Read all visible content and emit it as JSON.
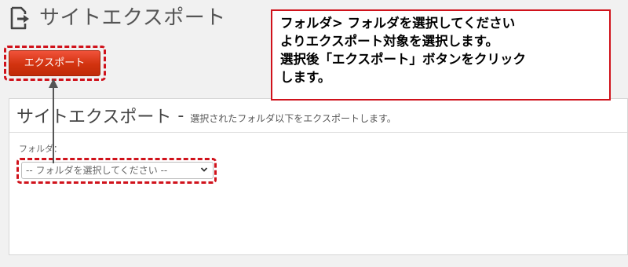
{
  "header": {
    "title": "サイトエクスポート",
    "icon": "export-document-icon"
  },
  "toolbar": {
    "export_label": "エクスポート"
  },
  "panel": {
    "title": "サイトエクスポート",
    "separator": "-",
    "description": "選択されたフォルダ以下をエクスポートします。",
    "folder_label": "フォルダ：",
    "folder_select": {
      "selected": "-- フォルダを選択してください --"
    }
  },
  "callout": {
    "lines": [
      "フォルダ> フォルダを選択してください",
      "よりエクスポート対象を選択します。",
      "選択後「エクスポート」ボタンをクリック",
      "します。"
    ]
  },
  "colors": {
    "button_red": "#d2330f",
    "highlight_red": "#d0121b"
  }
}
